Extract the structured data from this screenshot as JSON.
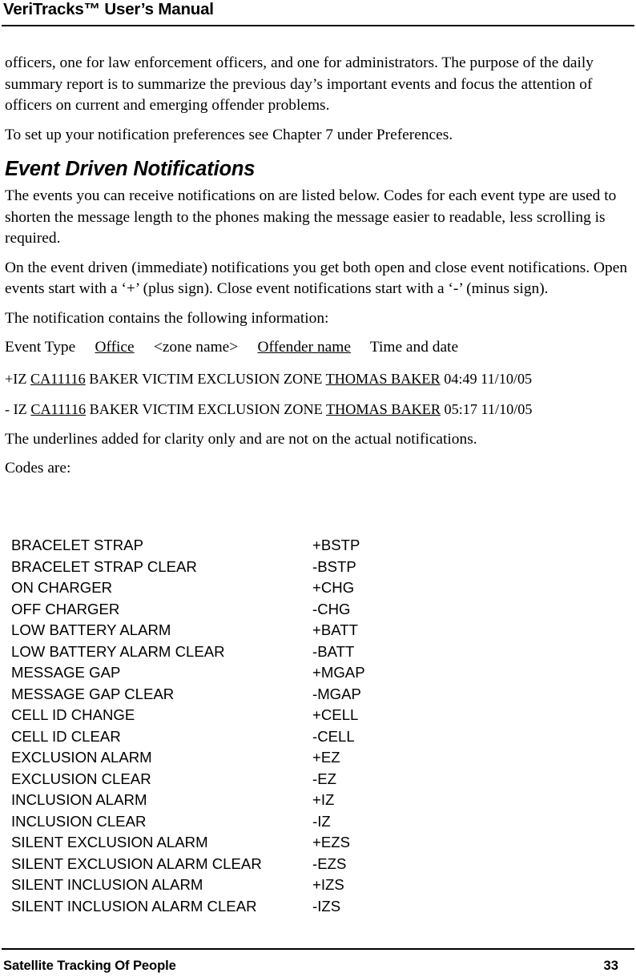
{
  "header": {
    "title": "VeriTracks™ User’s Manual"
  },
  "body": {
    "paragraph_1": "officers, one for law enforcement officers, and one for administrators.  The purpose of the daily summary report is to summarize the previous day’s important events and focus the attention of officers on current and emerging offender problems.",
    "paragraph_2": "To set up your notification preferences see Chapter 7 under Preferences.",
    "section_heading": "Event Driven Notifications",
    "paragraph_3": "The events you can receive notifications on are listed below.  Codes for each event type are used to shorten the message length to the phones making the message easier to readable, less scrolling is required.",
    "paragraph_4": "On the event driven (immediate) notifications you get both open and close event notifications.  Open events start with a ‘+’ (plus sign).  Close event notifications start with a ‘-’ (minus sign).",
    "paragraph_5": "The notification contains the following information:",
    "paragraph_6": "The underlines added for clarity only and are not on the actual notifications.",
    "paragraph_7": "Codes are:"
  },
  "format_line": {
    "event_type": "Event Type",
    "gap_1": "     ",
    "office": "Office",
    "gap_2": "     ",
    "zone_name": "<zone name>",
    "gap_3": "     ",
    "offender_name": "Offender name",
    "gap_4": "     ",
    "time_and_date": "Time and date"
  },
  "examples": [
    {
      "prefix": "+IZ ",
      "office": "CA11116",
      "middle": " BAKER VICTIM EXCLUSION ZONE ",
      "offender": "THOMAS BAKER",
      "suffix": " 04:49 11/10/05"
    },
    {
      "prefix": "- IZ ",
      "office": "CA11116",
      "middle": " BAKER VICTIM EXCLUSION ZONE ",
      "offender": "THOMAS BAKER",
      "suffix": " 05:17 11/10/05"
    }
  ],
  "codes_table": {
    "rows": [
      {
        "name": "BRACELET STRAP",
        "code": "+BSTP"
      },
      {
        "name": "BRACELET STRAP CLEAR",
        "code": "-BSTP"
      },
      {
        "name": "ON CHARGER",
        "code": "+CHG"
      },
      {
        "name": "OFF CHARGER",
        "code": "-CHG"
      },
      {
        "name": "LOW BATTERY ALARM",
        "code": "+BATT"
      },
      {
        "name": "LOW BATTERY ALARM CLEAR",
        "code": "-BATT"
      },
      {
        "name": "MESSAGE GAP",
        "code": "+MGAP"
      },
      {
        "name": "MESSAGE GAP CLEAR",
        "code": "-MGAP"
      },
      {
        "name": "CELL ID CHANGE",
        "code": "+CELL"
      },
      {
        "name": "CELL ID CLEAR",
        "code": "-CELL"
      },
      {
        "name": "EXCLUSION ALARM",
        "code": "+EZ"
      },
      {
        "name": "EXCLUSION CLEAR",
        "code": "-EZ"
      },
      {
        "name": "INCLUSION ALARM",
        "code": "+IZ"
      },
      {
        "name": "INCLUSION CLEAR",
        "code": "-IZ"
      },
      {
        "name": "SILENT EXCLUSION ALARM",
        "code": "+EZS"
      },
      {
        "name": "SILENT EXCLUSION ALARM CLEAR",
        "code": "-EZS"
      },
      {
        "name": "SILENT INCLUSION ALARM",
        "code": "+IZS"
      },
      {
        "name": "SILENT INCLUSION ALARM CLEAR",
        "code": "-IZS"
      }
    ]
  },
  "footer": {
    "company": "Satellite Tracking Of People",
    "page_number": "33"
  }
}
